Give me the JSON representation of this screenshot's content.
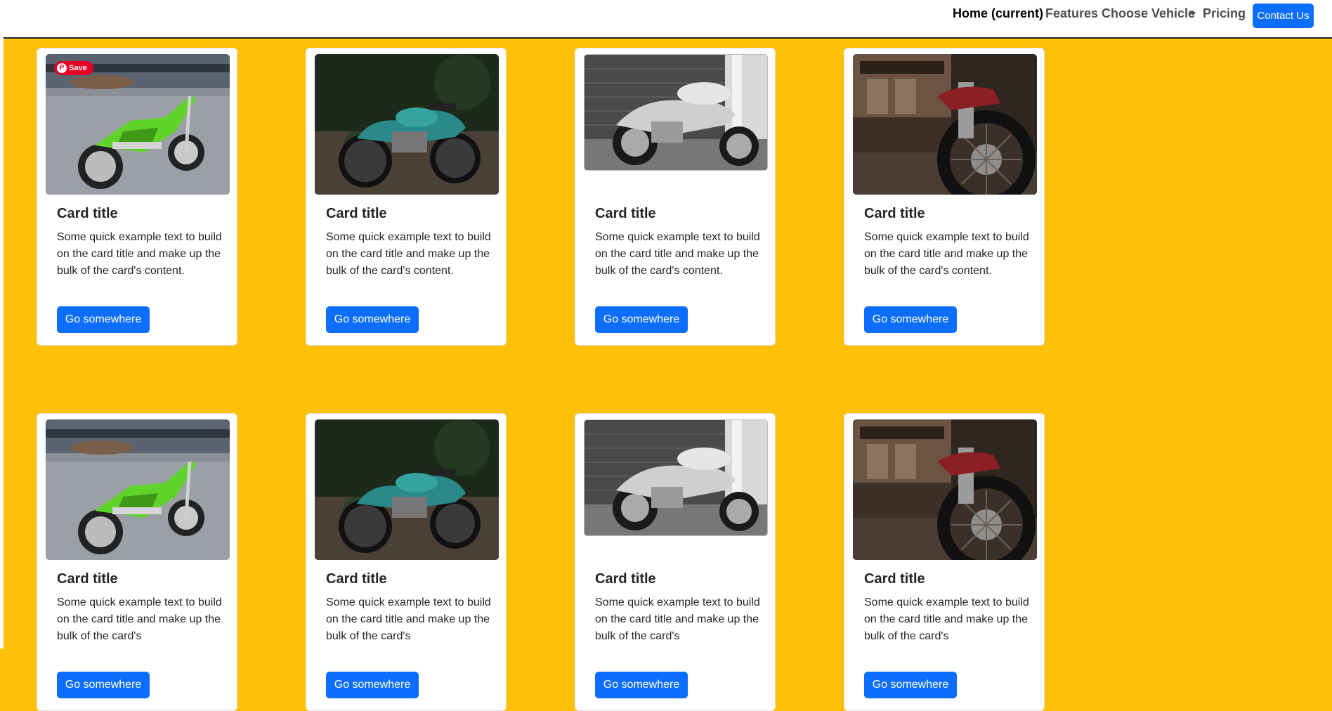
{
  "nav": {
    "home": "Home (current)",
    "features": "Features",
    "choose_vehicle": "Choose Vehicle",
    "pricing": "Pricing",
    "contact": "Contact Us"
  },
  "pin_save": "Save",
  "cards": [
    {
      "image": "green-chopper-motorcycle",
      "title": "Card title",
      "text": "Some quick example text to build on the card title and make up the bulk of the card's content.",
      "button": "Go somewhere"
    },
    {
      "image": "teal-classic-motorcycle",
      "title": "Card title",
      "text": "Some quick example text to build on the card title and make up the bulk of the card's content.",
      "button": "Go somewhere"
    },
    {
      "image": "silver-cruiser-motorcycle-bw",
      "title": "Card title",
      "text": "Some quick example text to build on the card title and make up the bulk of the card's content.",
      "button": "Go somewhere"
    },
    {
      "image": "vintage-motorcycle-front-wheel",
      "title": "Card title",
      "text": "Some quick example text to build on the card title and make up the bulk of the card's content.",
      "button": "Go somewhere"
    },
    {
      "image": "green-chopper-motorcycle",
      "title": "Card title",
      "text": "Some quick example text to build on the card title and make up the bulk of the card's",
      "button": "Go somewhere"
    },
    {
      "image": "teal-classic-motorcycle",
      "title": "Card title",
      "text": "Some quick example text to build on the card title and make up the bulk of the card's",
      "button": "Go somewhere"
    },
    {
      "image": "silver-cruiser-motorcycle-bw",
      "title": "Card title",
      "text": "Some quick example text to build on the card title and make up the bulk of the card's",
      "button": "Go somewhere"
    },
    {
      "image": "vintage-motorcycle-front-wheel",
      "title": "Card title",
      "text": "Some quick example text to build on the card title and make up the bulk of the card's",
      "button": "Go somewhere"
    }
  ],
  "colors": {
    "page_background": "#ffc107",
    "primary": "#0d6efd",
    "pinterest": "#e60023"
  }
}
